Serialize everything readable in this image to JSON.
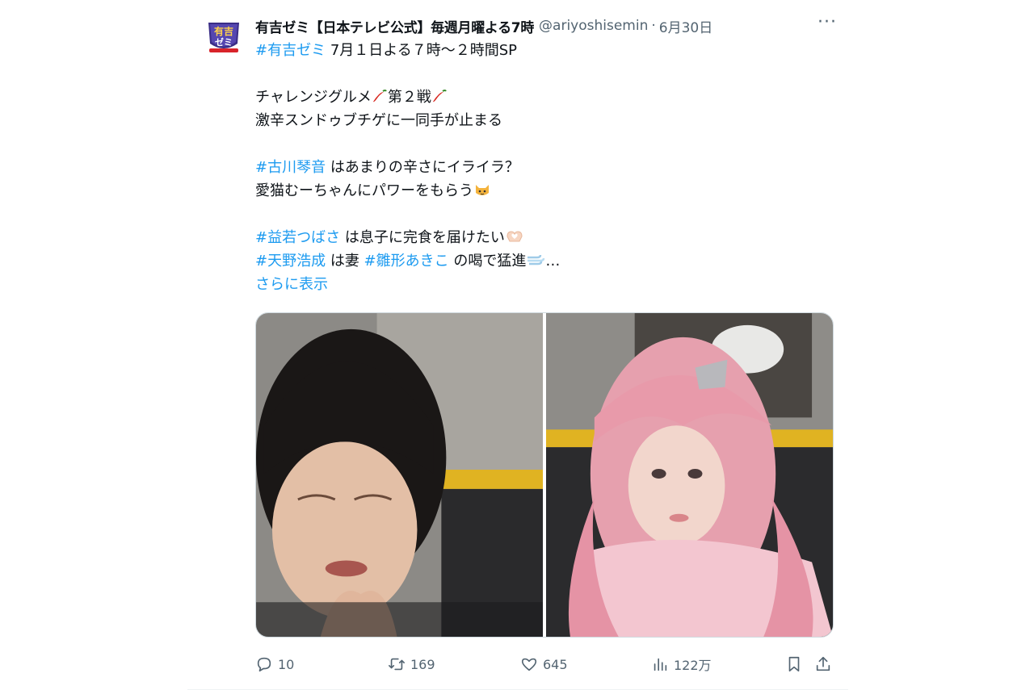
{
  "account": {
    "display_name": "有吉ゼミ【日本テレビ公式】毎週月曜よる7時",
    "handle": "@ariyoshisemin",
    "separator": "·",
    "date": "6月30日",
    "avatar_icon": "ariyoshi-zemi-logo",
    "avatar_text_top": "有吉",
    "avatar_text_bottom": "ゼミ"
  },
  "tweet": {
    "line1_tag": "#有吉ゼミ",
    "line1_text": " 7月１日よる７時～２時間SP",
    "line2_a": "チャレンジグルメ",
    "line2_b": "第２戦",
    "line3": "激辛スンドゥブチゲに一同手が止まる",
    "line4_tag": "#古川琴音",
    "line4_text": " はあまりの辛さにイライラ？",
    "line5": "愛猫むーちゃんにパワーをもらう",
    "line6_tag": "#益若つばさ",
    "line6_text": " は息子に完食を届けたい",
    "line7_tag1": "#天野浩成",
    "line7_text1": " は妻 ",
    "line7_tag2": "#雛形あきこ",
    "line7_text2": " の喝で猛進",
    "line7_ellipsis": "…",
    "show_more": "さらに表示",
    "emoji_pepper": "chili-pepper-icon",
    "emoji_cat": "cat-face-icon",
    "emoji_hands": "heart-hands-icon",
    "emoji_dash": "dash-icon"
  },
  "media": {
    "photos": [
      "woman-wincing-photo",
      "pink-hair-woman-photo"
    ]
  },
  "actions": {
    "replies": "10",
    "reposts": "169",
    "likes": "645",
    "views": "122万"
  },
  "colors": {
    "link": "#1d9bf0",
    "muted": "#536471",
    "text": "#0f1419"
  }
}
